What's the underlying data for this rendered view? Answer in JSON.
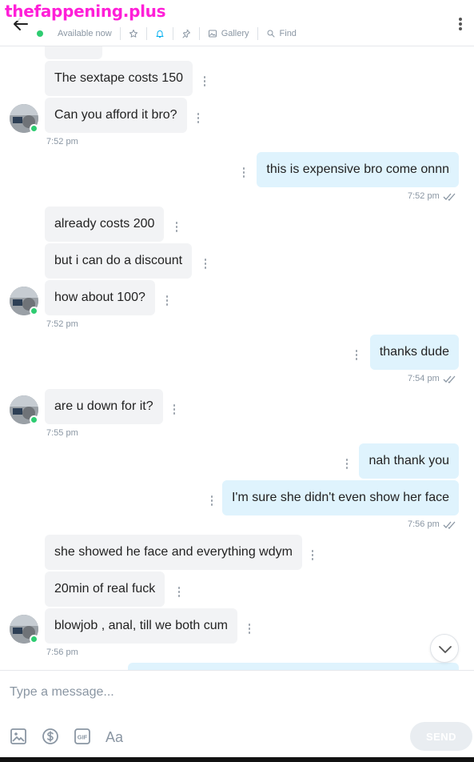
{
  "watermark": "thefappening.plus",
  "header": {
    "status": "Available now",
    "toolbar": [
      {
        "icon": "star-icon",
        "label": ""
      },
      {
        "icon": "bell-icon",
        "label": ""
      },
      {
        "icon": "pin-icon",
        "label": ""
      },
      {
        "icon": "gallery-icon",
        "label": "Gallery"
      },
      {
        "icon": "search-icon",
        "label": "Find"
      }
    ],
    "accent": "#00aff0",
    "online_color": "#2ecc71"
  },
  "messages": [
    {
      "dir": "in",
      "text": "The sextape costs 150"
    },
    {
      "dir": "in",
      "text": "Can you afford it bro?",
      "avatar": true
    },
    {
      "dir": "in_time",
      "time": "7:52 pm"
    },
    {
      "dir": "out",
      "text": "this is expensive bro come onnn"
    },
    {
      "dir": "out_time",
      "time": "7:52 pm"
    },
    {
      "dir": "in",
      "text": "already costs 200"
    },
    {
      "dir": "in",
      "text": "but i can do a discount"
    },
    {
      "dir": "in",
      "text": "how about 100?",
      "avatar": true
    },
    {
      "dir": "in_time",
      "time": "7:52 pm"
    },
    {
      "dir": "out",
      "text": "thanks dude"
    },
    {
      "dir": "out_time",
      "time": "7:54 pm"
    },
    {
      "dir": "in",
      "text": "are u down for it?",
      "avatar": true
    },
    {
      "dir": "in_time",
      "time": "7:55 pm"
    },
    {
      "dir": "out",
      "text": "nah thank you"
    },
    {
      "dir": "out",
      "text": "I'm sure she didn't even show her face"
    },
    {
      "dir": "out_time",
      "time": "7:56 pm"
    },
    {
      "dir": "in",
      "text": "she showed he face and everything wdym"
    },
    {
      "dir": "in",
      "text": "20min of real fuck"
    },
    {
      "dir": "in",
      "text": "blowjob , anal, till we both cum",
      "avatar": true
    },
    {
      "dir": "in_time",
      "time": "7:56 pm"
    }
  ],
  "composer": {
    "placeholder": "Type a message...",
    "value": "",
    "send_label": "SEND",
    "tools": [
      "image-icon",
      "dollar-icon",
      "gif-icon",
      "text-format-icon"
    ],
    "text_format_label": "Aa",
    "gif_label": "GIF"
  }
}
